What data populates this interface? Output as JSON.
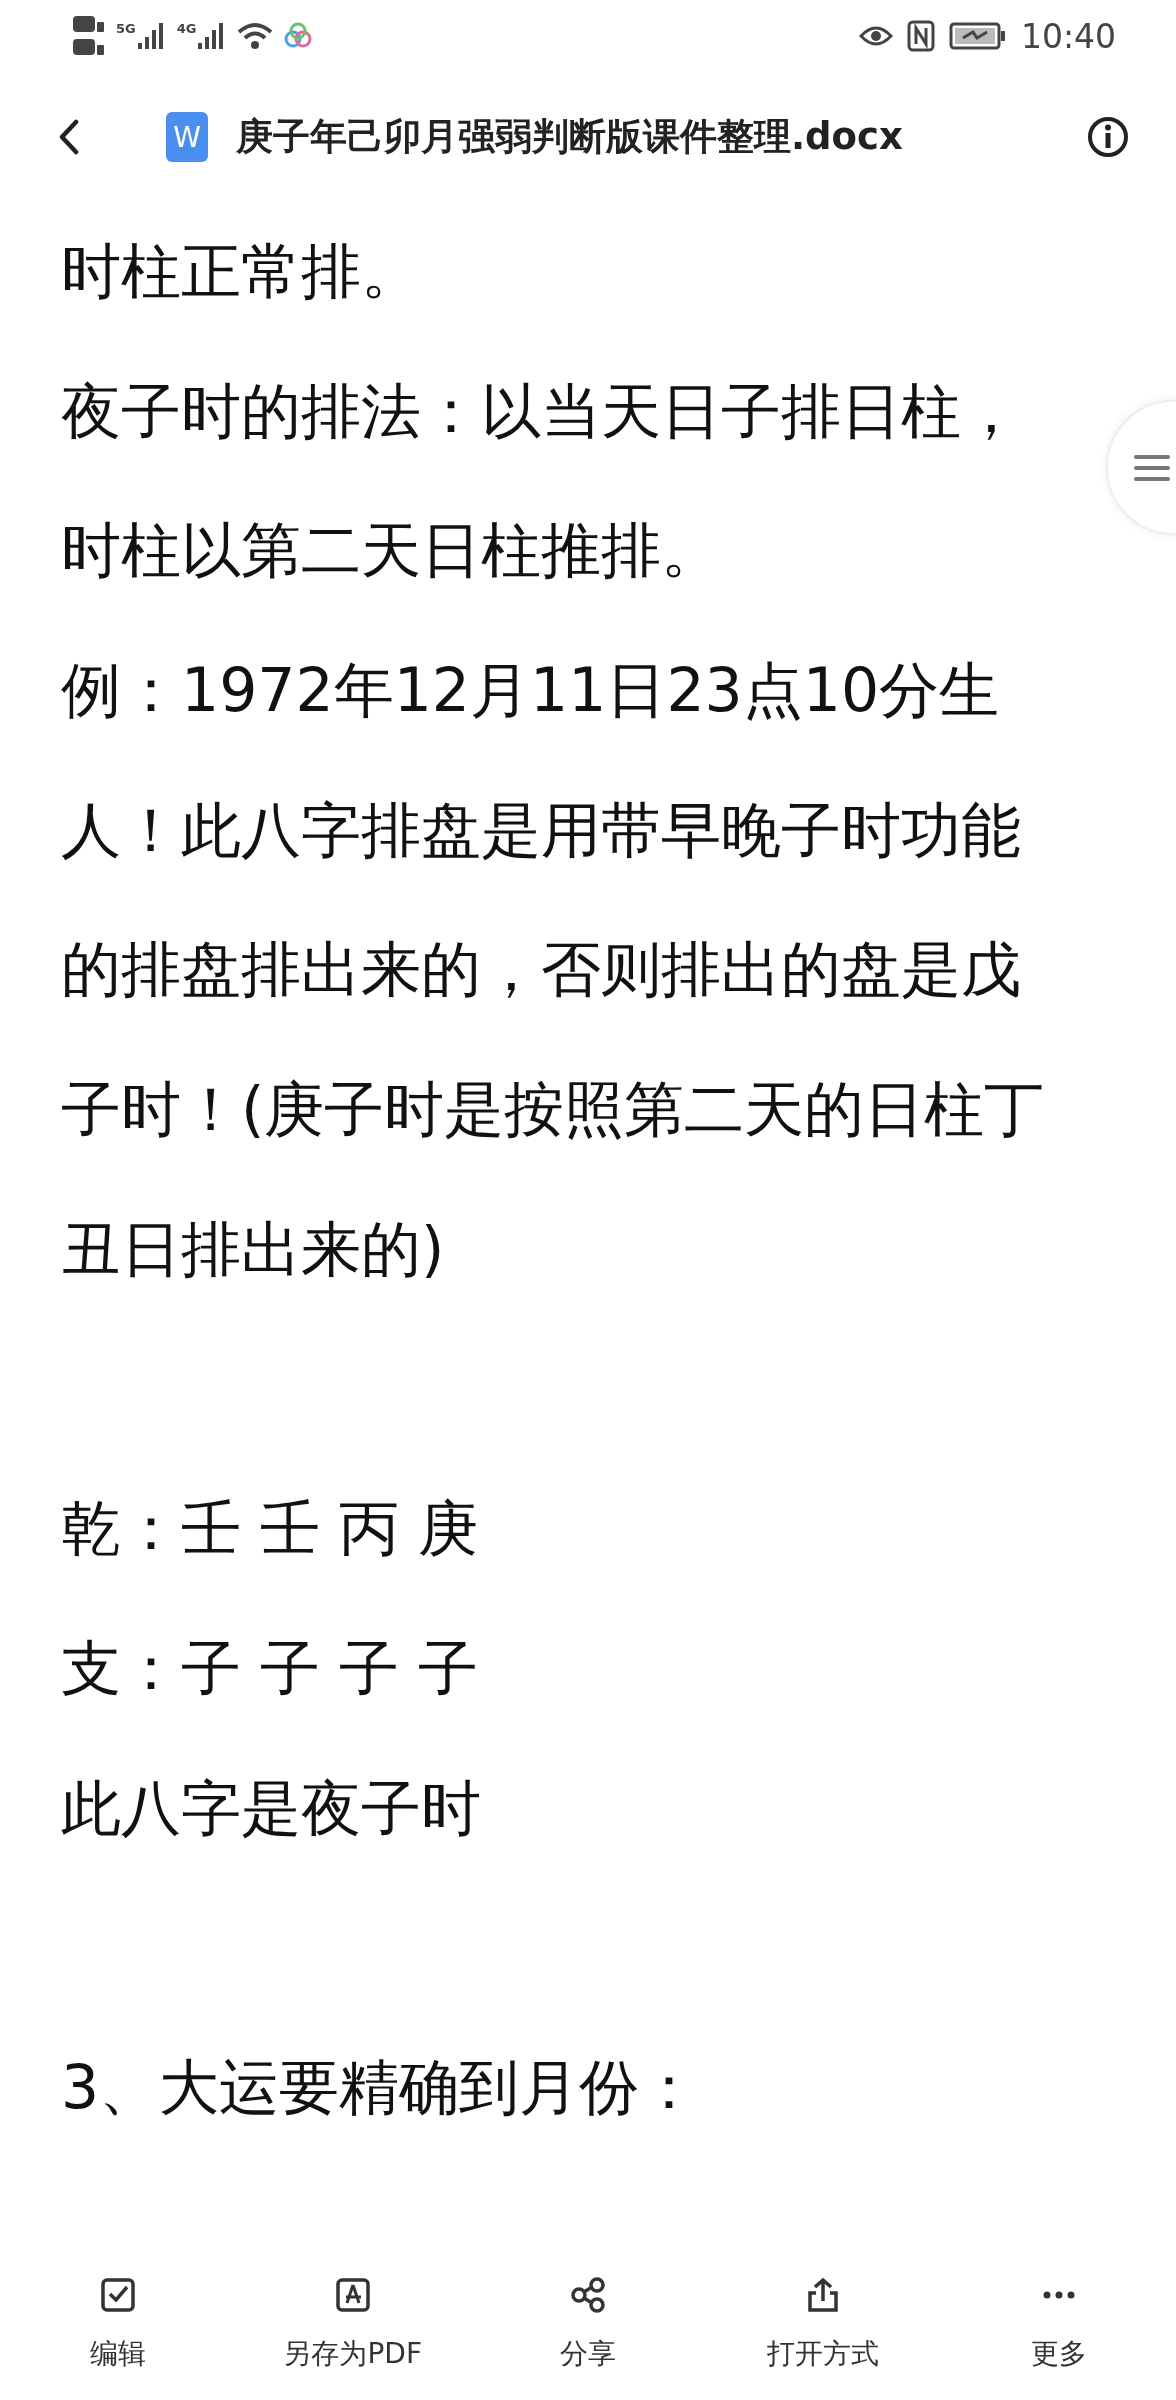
{
  "status_bar": {
    "networks": [
      "5G",
      "4G"
    ],
    "time": "10:40"
  },
  "header": {
    "file_badge": "W",
    "title": "庚子年己卯月强弱判断版课件整理.docx"
  },
  "document": {
    "blocks": [
      [
        "时柱正常排。",
        "夜子时的排法：以当天日子排日柱，",
        "时柱以第二天日柱推排。",
        "例：1972年12月11日23点10分生",
        "人！此八字排盘是用带早晚子时功能",
        "的排盘排出来的，否则排出的盘是戊",
        "子时！(庚子时是按照第二天的日柱丁",
        "丑日排出来的)"
      ],
      [
        "乾：壬 壬 丙 庚",
        "支：子 子 子 子",
        "此八字是夜子时"
      ],
      [
        "3、大运要精确到月份："
      ]
    ]
  },
  "toolbar": [
    {
      "kind": "edit",
      "label": "编辑"
    },
    {
      "kind": "pdf",
      "label": "另存为PDF"
    },
    {
      "kind": "share",
      "label": "分享"
    },
    {
      "kind": "open",
      "label": "打开方式"
    },
    {
      "kind": "more",
      "label": "更多"
    }
  ]
}
